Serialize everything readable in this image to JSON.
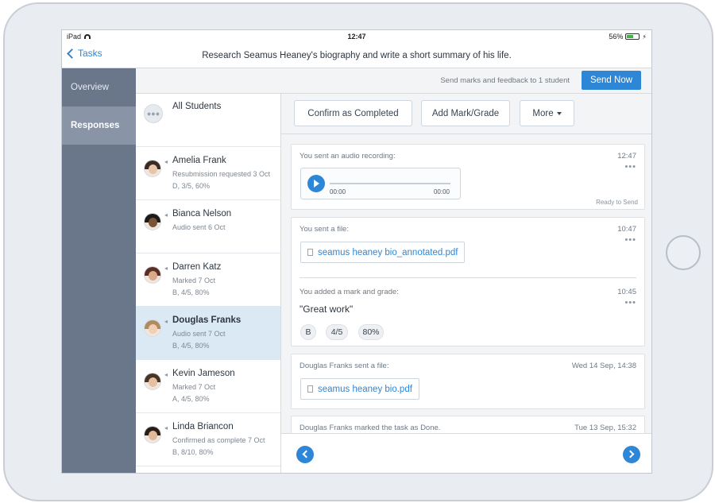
{
  "status_bar": {
    "device": "iPad",
    "time": "12:47",
    "battery": "56%",
    "battery_level": 0.56
  },
  "nav": {
    "back_label": "Tasks",
    "title": "Research Seamus Heaney's biography and write a short summary of his life."
  },
  "left_tabs": [
    {
      "label": "Overview",
      "active": false
    },
    {
      "label": "Responses",
      "active": true
    }
  ],
  "send_bar": {
    "info": "Send marks and feedback to 1 student",
    "button": "Send Now"
  },
  "students": {
    "all_label": "All Students",
    "items": [
      {
        "name": "Amelia Frank",
        "line1": "Resubmission requested 3 Oct",
        "line2": "D, 3/5, 60%",
        "selected": false
      },
      {
        "name": "Bianca Nelson",
        "line1": "Audio sent 6 Oct",
        "line2": "",
        "selected": false
      },
      {
        "name": "Darren Katz",
        "line1": "Marked 7 Oct",
        "line2": "B, 4/5, 80%",
        "selected": false
      },
      {
        "name": "Douglas Franks",
        "line1": "Audio sent 7 Oct",
        "line2": "B, 4/5, 80%",
        "selected": true
      },
      {
        "name": "Kevin Jameson",
        "line1": "Marked 7 Oct",
        "line2": "A, 4/5, 80%",
        "selected": false
      },
      {
        "name": "Linda Briancon",
        "line1": "Confirmed as complete 7 Oct",
        "line2": "B, 8/10, 80%",
        "selected": false
      }
    ]
  },
  "actions": {
    "confirm": "Confirm as Completed",
    "add_mark": "Add Mark/Grade",
    "more": "More"
  },
  "feed": {
    "audio_card": {
      "label": "You sent an audio recording:",
      "time": "12:47",
      "more": "•••",
      "start": "00:00",
      "end": "00:00",
      "status": "Ready to Send"
    },
    "file_card": {
      "label": "You sent a file:",
      "time": "10:47",
      "more": "•••",
      "file": "seamus heaney bio_annotated.pdf",
      "mark_label": "You added a mark and grade:",
      "mark_time": "10:45",
      "mark_more": "•••",
      "comment": "\"Great work\"",
      "grade": "B",
      "score": "4/5",
      "percent": "80%"
    },
    "student_file_card": {
      "label": "Douglas Franks sent a file:",
      "time": "Wed 14 Sep, 14:38",
      "file": "seamus heaney bio.pdf"
    },
    "done_card": {
      "label": "Douglas Franks marked the task as Done.",
      "time": "Tue 13 Sep, 15:32"
    }
  },
  "icons": {
    "back": "chevron-left-icon",
    "play": "play-icon",
    "prev": "chevron-left-icon",
    "next": "chevron-right-icon"
  },
  "colors": {
    "accent": "#2e86d6",
    "sidebar": "#6a7689",
    "selected_row": "#dbe9f5"
  }
}
